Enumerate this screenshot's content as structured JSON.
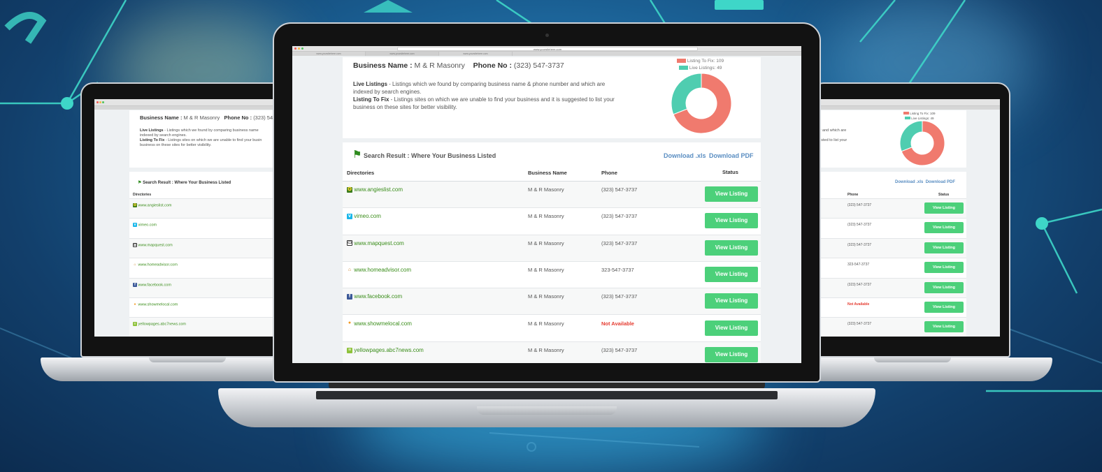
{
  "business": {
    "name_label": "Business Name :",
    "name": "M & R Masonry",
    "phone_label": "Phone No :",
    "phone": "(323) 547-3737",
    "phone_short": "(323) 547"
  },
  "info": {
    "live_label": "Live Listings",
    "live_text_1": " - Listings which we found by comparing business name & phone number and which are",
    "live_text_2": "indexed by search engines.",
    "fix_label": "Listing To Fix",
    "fix_text_1": " - Listings sites on which we are unable to find your business and it is suggested to list your",
    "fix_text_2": "business on these sites for better visibility.",
    "left_live_text": " - Listings which we found by comparing business name",
    "left_live_text_2": "indexed by search engines.",
    "left_fix_text": " - Listings sites on which we are unable to find your busin",
    "left_fix_text_2": "business on these sites for better visibility.",
    "right_live_text": "mber and which are",
    "right_fix_text": "uggested to list your"
  },
  "chart_data": {
    "type": "pie",
    "categories": [
      "Listing To Fix",
      "Live Listings"
    ],
    "values": [
      109,
      49
    ],
    "legend": [
      "Listing To Fix: 109",
      "Live Listings: 49"
    ],
    "colors": [
      "#f07a6e",
      "#4fcdb0"
    ],
    "donut": true
  },
  "results": {
    "title": "Search Result : Where Your Business Listed",
    "download_xls": "Download .xls",
    "download_pdf": "Download PDF",
    "headers": [
      "Directories",
      "Business Name",
      "Phone",
      "Status"
    ],
    "button_label": "View Listing",
    "rows": [
      {
        "site": "www.angieslist.com",
        "icon": "angies-list-icon",
        "name": "M & R Masonry",
        "phone": "(323) 547-3737",
        "status": "ok"
      },
      {
        "site": "vimeo.com",
        "icon": "vimeo-icon",
        "name": "M & R Masonry",
        "phone": "(323) 547-3737",
        "status": "ok"
      },
      {
        "site": "www.mapquest.com",
        "icon": "mapquest-icon",
        "name": "M & R Masonry",
        "phone": "(323) 547-3737",
        "status": "ok"
      },
      {
        "site": "www.homeadvisor.com",
        "icon": "homeadvisor-icon",
        "name": "M & R Masonry",
        "phone": "323-547-3737",
        "status": "ok"
      },
      {
        "site": "www.facebook.com",
        "icon": "facebook-icon",
        "name": "M & R Masonry",
        "phone": "(323) 547-3737",
        "status": "ok"
      },
      {
        "site": "www.showmelocal.com",
        "icon": "showmelocal-icon",
        "name": "M & R Masonry",
        "phone": "Not Available",
        "status": "na"
      },
      {
        "site": "yellowpages.abc7news.com",
        "icon": "yellowpages-icon",
        "name": "M & R Masonry",
        "phone": "(323) 547-3737",
        "status": "ok"
      }
    ]
  },
  "browser": {
    "address": "www.yoursitehere.com",
    "tabs": [
      "www.yoursitehere.com",
      "www.yoursitehere.com",
      "www.yoursitehere.com"
    ]
  },
  "colors": {
    "accent_green": "#4cd07a",
    "link_green": "#3a8d1a",
    "link_blue": "#5a8ec2",
    "not_available_red": "#e53b30"
  }
}
